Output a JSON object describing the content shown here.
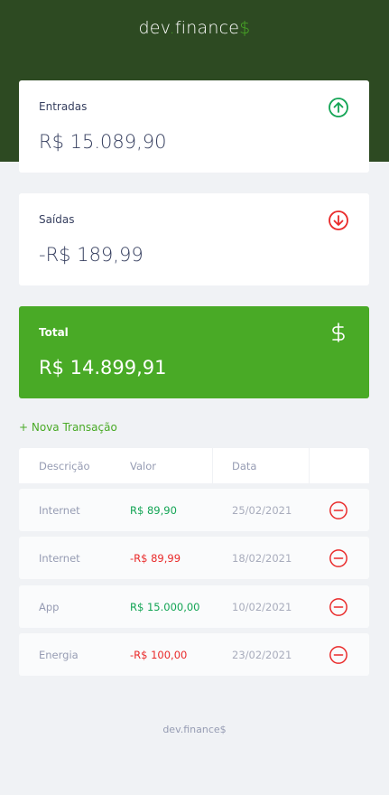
{
  "header": {
    "logo_part1": "dev",
    "logo_dot": ".",
    "logo_part2": "finance",
    "logo_dollar": "$"
  },
  "cards": {
    "income": {
      "label": "Entradas",
      "value": "R$ 15.089,90",
      "icon": "arrow-up-circle-icon",
      "color": "#12a454"
    },
    "expense": {
      "label": "Saídas",
      "value": "-R$ 189,99",
      "icon": "arrow-down-circle-icon",
      "color": "#e92929"
    },
    "total": {
      "label": "Total",
      "value": "R$ 14.899,91",
      "icon": "dollar-sign-icon",
      "color": "#49aa26"
    }
  },
  "new_transaction_label": "+ Nova Transação",
  "table": {
    "headers": [
      "Descrição",
      "Valor",
      "Data"
    ],
    "rows": [
      {
        "description": "Internet",
        "amount": "R$ 89,90",
        "date": "25/02/2021",
        "type": "income"
      },
      {
        "description": "Internet",
        "amount": "-R$ 89,99",
        "date": "18/02/2021",
        "type": "expense"
      },
      {
        "description": "App",
        "amount": "R$ 15.000,00",
        "date": "10/02/2021",
        "type": "income"
      },
      {
        "description": "Energia",
        "amount": "-R$ 100,00",
        "date": "23/02/2021",
        "type": "expense"
      }
    ]
  },
  "footer": "dev.finance$",
  "colors": {
    "header_bg": "#2d4a22",
    "brand_green": "#49aa26",
    "income": "#12a454",
    "expense": "#e92929",
    "text": "#363f5f",
    "muted": "#969cb3"
  }
}
